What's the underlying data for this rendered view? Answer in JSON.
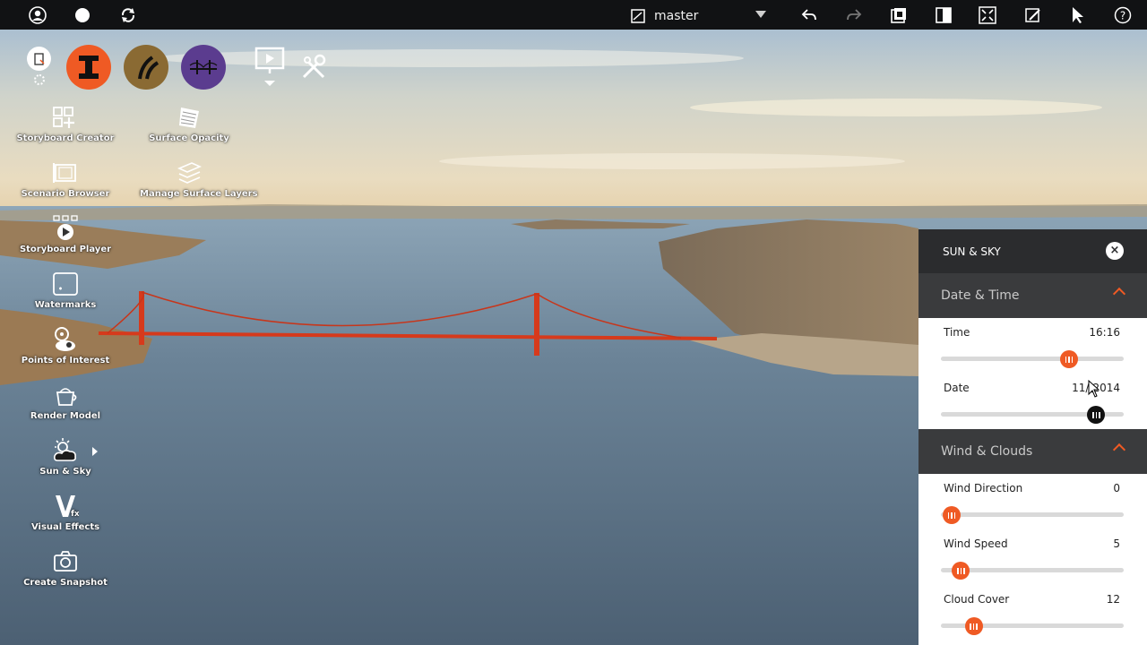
{
  "topbar": {
    "branch": "master",
    "icons": [
      "user-icon",
      "chat-icon",
      "sync-icon",
      "back-icon",
      "forward-icon",
      "layers-icon",
      "panel-icon",
      "fullscreen-icon",
      "edit-view-icon",
      "pointer-icon",
      "help-icon"
    ]
  },
  "palette": {
    "circles": [
      {
        "name": "infrastructure-icon",
        "color": "#ef5a24"
      },
      {
        "name": "roads-icon",
        "color": "#8a6a33"
      },
      {
        "name": "bridges-icon",
        "color": "#5b3c8f"
      }
    ],
    "tools_left": [
      {
        "label": "Storyboard Creator",
        "icon": "storyboard-creator-icon"
      },
      {
        "label": "Scenario Browser",
        "icon": "scenario-browser-icon"
      },
      {
        "label": "Storyboard Player",
        "icon": "storyboard-player-icon"
      },
      {
        "label": "Watermarks",
        "icon": "watermarks-icon"
      },
      {
        "label": "Points of Interest",
        "icon": "points-of-interest-icon"
      },
      {
        "label": "Render Model",
        "icon": "render-model-icon"
      },
      {
        "label": "Sun & Sky",
        "icon": "sun-sky-icon"
      },
      {
        "label": "Visual Effects",
        "icon": "visual-effects-icon"
      },
      {
        "label": "Create Snapshot",
        "icon": "camera-icon"
      }
    ],
    "tools_right": [
      {
        "label": "Surface Opacity",
        "icon": "surface-opacity-icon"
      },
      {
        "label": "Manage Surface Layers",
        "icon": "surface-layers-icon"
      }
    ]
  },
  "panel": {
    "title": "SUN & SKY",
    "close": "×",
    "date_time": {
      "heading": "Date & Time",
      "time_label": "Time",
      "time_value": "16:16",
      "time_level": 0.7,
      "date_label": "Date",
      "date_value": "11/\\2014",
      "date_level": 0.85
    },
    "wind_clouds": {
      "heading": "Wind & Clouds",
      "direction_label": "Wind Direction",
      "direction_value": "0",
      "direction_level": 0.06,
      "speed_label": "Wind Speed",
      "speed_value": "5",
      "speed_level": 0.11,
      "cloud_label": "Cloud Cover",
      "cloud_value": "12",
      "cloud_level": 0.18
    }
  },
  "colors": {
    "accent": "#ef5a24",
    "panel_dark": "#2b2c2e",
    "section_dark": "#3a3b3d"
  }
}
